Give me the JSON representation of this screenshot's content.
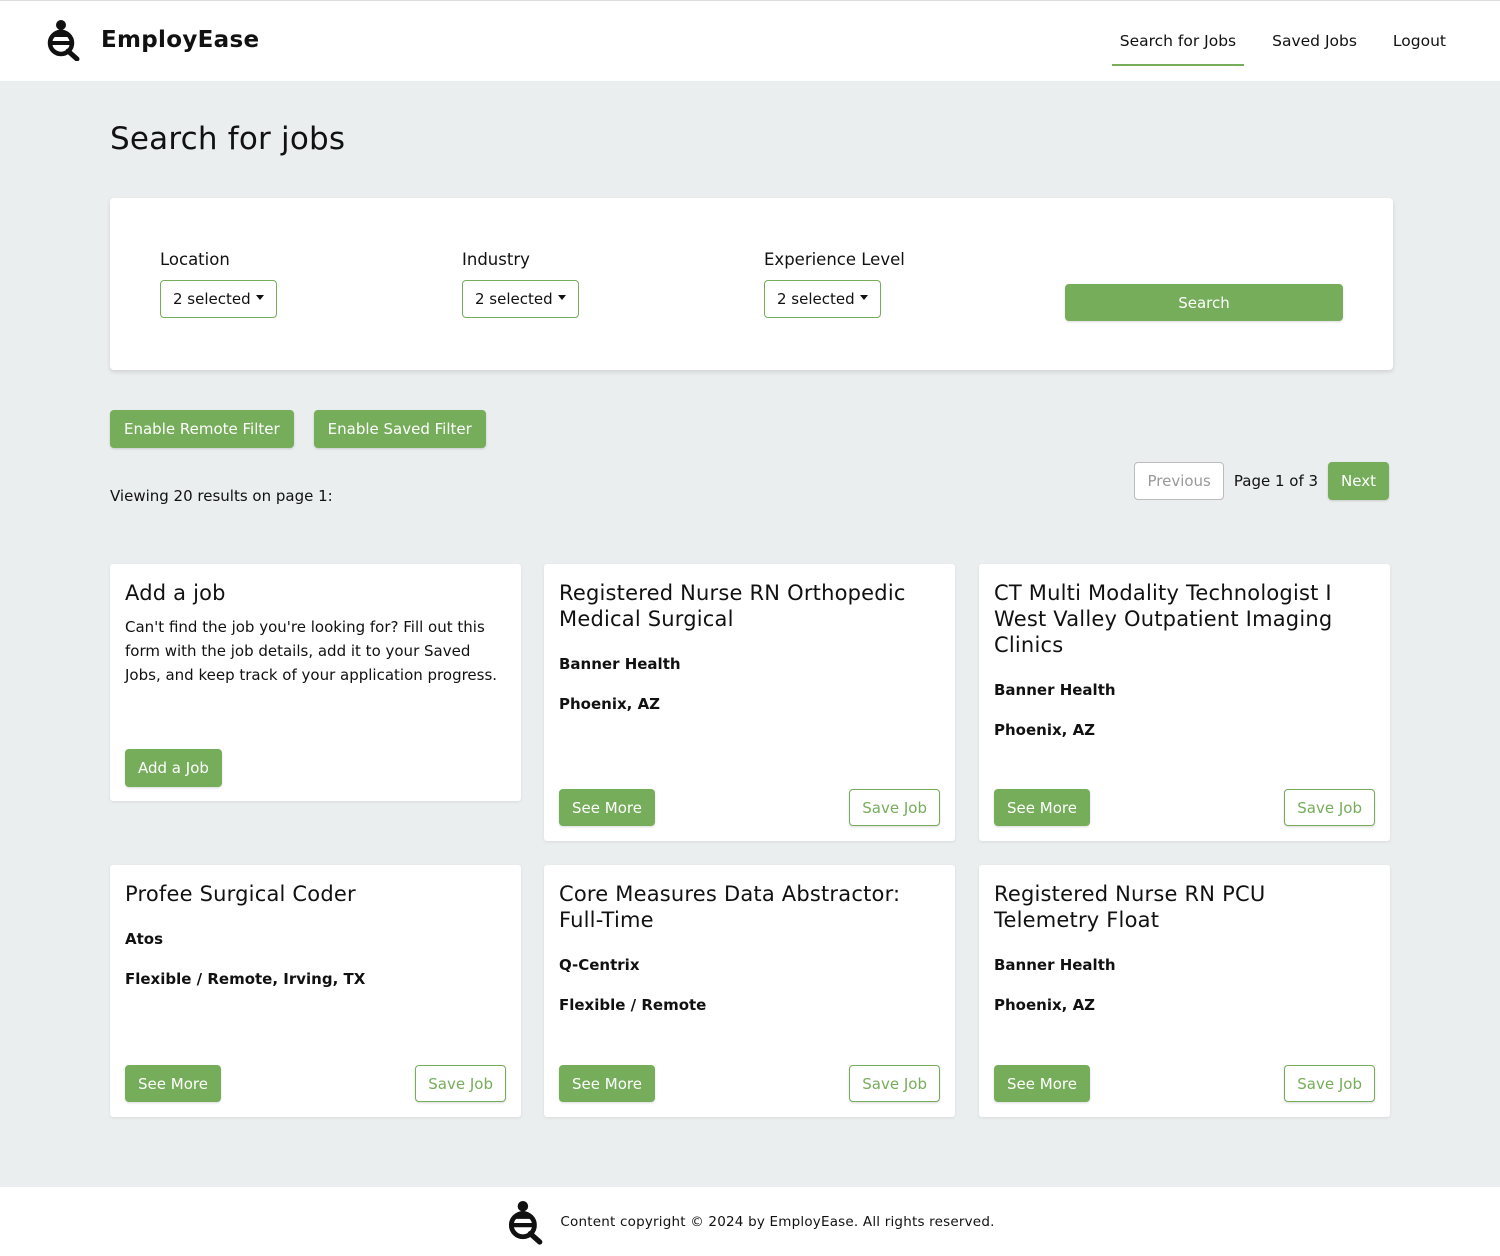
{
  "brand": {
    "name": "EmployEase",
    "logo": "employease-logo-icon"
  },
  "nav": {
    "items": [
      {
        "label": "Search for Jobs",
        "active": true
      },
      {
        "label": "Saved Jobs",
        "active": false
      },
      {
        "label": "Logout",
        "active": false
      }
    ]
  },
  "page": {
    "title": "Search for jobs"
  },
  "filters": {
    "location": {
      "label": "Location",
      "value": "2 selected"
    },
    "industry": {
      "label": "Industry",
      "value": "2 selected"
    },
    "experience": {
      "label": "Experience Level",
      "value": "2 selected"
    },
    "search_label": "Search"
  },
  "toggles": {
    "remote_label": "Enable Remote Filter",
    "saved_label": "Enable Saved Filter"
  },
  "results": {
    "viewing_text": "Viewing 20 results on page 1:"
  },
  "pagination": {
    "previous_label": "Previous",
    "page_info": "Page 1 of 3",
    "next_label": "Next"
  },
  "add_job_card": {
    "title": "Add a job",
    "text": "Can't find the job you're looking for? Fill out this form with the job details, add it to your Saved Jobs, and keep track of your application progress.",
    "button_label": "Add a Job"
  },
  "job_buttons": {
    "see_more_label": "See More",
    "save_job_label": "Save Job"
  },
  "jobs": [
    {
      "title": "Registered Nurse RN Orthopedic Medical Surgical",
      "company": "Banner Health",
      "location": "Phoenix, AZ"
    },
    {
      "title": "CT Multi Modality Technologist I West Valley Outpatient Imaging Clinics",
      "company": "Banner Health",
      "location": "Phoenix, AZ"
    },
    {
      "title": "Profee Surgical Coder",
      "company": "Atos",
      "location": "Flexible / Remote, Irving, TX"
    },
    {
      "title": "Core Measures Data Abstractor: Full-Time",
      "company": "Q-Centrix",
      "location": "Flexible / Remote"
    },
    {
      "title": "Registered Nurse RN PCU Telemetry Float",
      "company": "Banner Health",
      "location": "Phoenix, AZ"
    }
  ],
  "footer": {
    "text": "Content copyright © 2024 by EmployEase. All rights reserved."
  },
  "colors": {
    "accent": "#76ad5a",
    "page_bg": "#ebeeee",
    "card_bg": "#ffffff"
  }
}
